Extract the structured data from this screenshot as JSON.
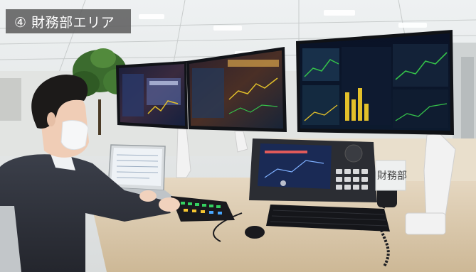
{
  "caption": {
    "label": "④ 財務部エリア"
  },
  "sign": {
    "text": "財務部"
  },
  "colors": {
    "caption_background": "#5f5f5f",
    "caption_text": "#ffffff",
    "screen_glow": "#1a2a55",
    "chart_green": "#35c24a",
    "chart_yellow": "#e3c02a"
  }
}
